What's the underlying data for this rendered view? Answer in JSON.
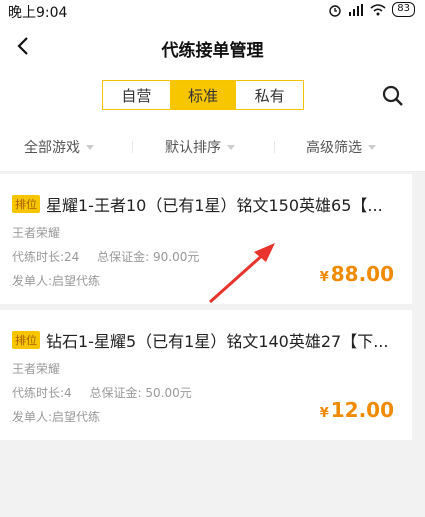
{
  "status": {
    "time": "晚上9:04",
    "battery": "83"
  },
  "header": {
    "title": "代练接单管理"
  },
  "tabs": [
    {
      "label": "自营"
    },
    {
      "label": "标准",
      "active": true
    },
    {
      "label": "私有"
    }
  ],
  "filters": {
    "game": "全部游戏",
    "sort": "默认排序",
    "advanced": "高级筛选"
  },
  "orders": [
    {
      "tag": "排位",
      "title": "星耀1-王者10（已有1星）铭文150英雄65【...",
      "game": "王者荣耀",
      "duration": "代练时长:24",
      "deposit": "总保证金: 90.00元",
      "publisher": "发单人:启望代练",
      "currency": "¥",
      "price": "88.00"
    },
    {
      "tag": "排位",
      "title": "钻石1-星耀5（已有1星）铭文140英雄27【下...",
      "game": "王者荣耀",
      "duration": "代练时长:4",
      "deposit": "总保证金: 50.00元",
      "publisher": "发单人:启望代练",
      "currency": "¥",
      "price": "12.00"
    }
  ],
  "colors": {
    "accent": "#f7c600",
    "price": "#f08a00",
    "arrow": "#e8342c"
  },
  "icons": [
    "alarm-icon",
    "signal-icon",
    "wifi-icon",
    "battery-icon",
    "back-arrow-icon",
    "search-icon",
    "dropdown-triangle-icon"
  ]
}
